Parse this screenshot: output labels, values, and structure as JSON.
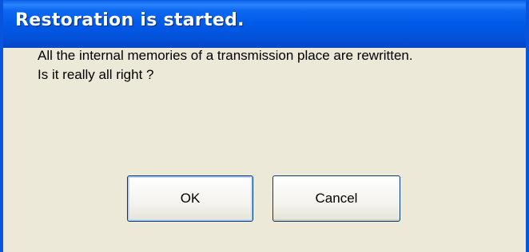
{
  "window": {
    "title": "Restoration is started."
  },
  "message": {
    "line1": "All the internal memories of a transmission place are rewritten.",
    "line2": "Is it really all right ?"
  },
  "buttons": {
    "ok_label": "OK",
    "cancel_label": "Cancel"
  },
  "colors": {
    "titlebar": "#0058e6",
    "dialog_background": "#ece9d8",
    "button_border": "#003c74",
    "title_text": "#ffffff"
  }
}
